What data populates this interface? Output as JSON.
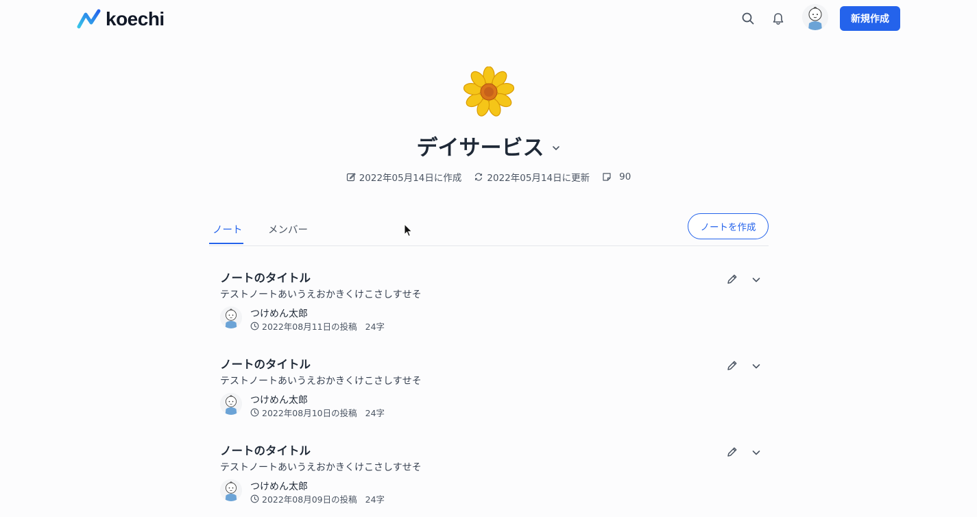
{
  "header": {
    "logo_text": "koechi",
    "new_button_label": "新規作成",
    "icons": [
      "search-icon",
      "bell-icon"
    ]
  },
  "group": {
    "emoji": "🌼",
    "title": "デイサービス",
    "created": "2022年05月14日に作成",
    "updated": "2022年05月14日に更新",
    "note_count": "90"
  },
  "tabs": [
    {
      "label": "ノート",
      "active": true
    },
    {
      "label": "メンバー",
      "active": false
    }
  ],
  "create_note_label": "ノートを作成",
  "notes": [
    {
      "title": "ノートのタイトル",
      "body": "テストノートあいうえおかきくけこさしすせそ",
      "author": "つけめん太郎",
      "posted": "2022年08月11日の投稿",
      "chars": "24字"
    },
    {
      "title": "ノートのタイトル",
      "body": "テストノートあいうえおかきくけこさしすせそ",
      "author": "つけめん太郎",
      "posted": "2022年08月10日の投稿",
      "chars": "24字"
    },
    {
      "title": "ノートのタイトル",
      "body": "テストノートあいうえおかきくけこさしすせそ",
      "author": "つけめん太郎",
      "posted": "2022年08月09日の投稿",
      "chars": "24字"
    }
  ],
  "colors": {
    "accent": "#2463eb",
    "text": "#1f2937",
    "muted": "#4b5563"
  }
}
